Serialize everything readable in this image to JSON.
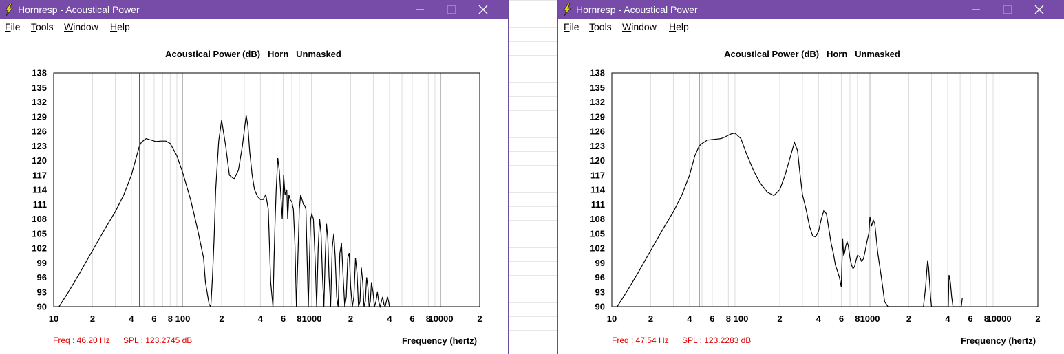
{
  "windows": [
    {
      "title": "Hornresp - Acoustical Power",
      "menu": [
        {
          "key": "F",
          "rest": "ile"
        },
        {
          "key": "T",
          "rest": "ools"
        },
        {
          "key": "W",
          "rest": "indow"
        },
        {
          "key": "H",
          "rest": "elp"
        }
      ],
      "chart_data": {
        "type": "line",
        "title": "Acoustical Power (dB)   Horn   Unmasked",
        "xlabel": "Frequency (hertz)",
        "ylabel": "",
        "x_scale": "log",
        "xlim": [
          10,
          20000
        ],
        "ylim": [
          90,
          138
        ],
        "y_ticks": [
          138,
          135,
          132,
          129,
          126,
          123,
          120,
          117,
          114,
          111,
          108,
          105,
          102,
          99,
          96,
          93,
          90
        ],
        "x_tick_labels": [
          "10",
          "2",
          "4",
          "6",
          "8",
          "100",
          "2",
          "4",
          "6",
          "8",
          "1000",
          "2",
          "4",
          "6",
          "8",
          "10000",
          "2"
        ],
        "x_tick_values": [
          10,
          20,
          40,
          60,
          80,
          100,
          200,
          400,
          600,
          800,
          1000,
          2000,
          4000,
          6000,
          8000,
          10000,
          20000
        ],
        "grid": true,
        "cursor_freq": 46.2,
        "line_color": "#000000",
        "cursor_color": "#e00000",
        "series": [
          {
            "x": [
              11,
              13,
              16,
              20,
              25,
              30,
              35,
              40,
              44,
              46.2,
              48,
              52,
              57,
              62,
              68,
              74,
              80,
              90,
              100,
              115,
              130,
              145,
              150,
              160,
              165,
              170,
              175,
              180,
              190,
              200,
              215,
              230,
              250,
              270,
              290,
              310,
              320,
              330,
              345,
              360,
              380,
              400,
              420,
              440,
              460,
              480,
              500,
              510,
              520,
              530,
              545,
              560,
              575,
              590,
              605,
              620,
              640,
              650,
              665,
              680,
              700,
              720,
              740,
              760,
              780,
              800,
              820,
              840,
              860,
              880,
              900,
              920,
              940,
              960,
              980,
              1000,
              1030,
              1060,
              1090,
              1120,
              1150,
              1180,
              1210,
              1240,
              1270,
              1300,
              1330,
              1360,
              1400,
              1440,
              1480,
              1520,
              1560,
              1600,
              1650,
              1700,
              1750,
              1800,
              1850,
              1900,
              1950,
              2000,
              2060,
              2120,
              2180,
              2240,
              2300,
              2360,
              2420,
              2480,
              2540,
              2600,
              2660,
              2720,
              2780,
              2840,
              2900,
              2980,
              3060,
              3140,
              3220,
              3300,
              3380,
              3460,
              3540,
              3620,
              3700,
              3780,
              3860,
              3940,
              4000,
              4040,
              4080
            ],
            "y": [
              90,
              93,
              97,
              101.5,
              106,
              109.5,
              113,
              117,
              121,
              123,
              123.8,
              124.5,
              124.2,
              123.9,
              124,
              124,
              123.5,
              121,
              117.5,
              112,
              106,
              100,
              95,
              90.5,
              90,
              96,
              104,
              114,
              124,
              128.3,
              123,
              117,
              116.2,
              118,
              123,
              129.3,
              127,
              122,
              117,
              114,
              112.6,
              112,
              112,
              113,
              110,
              95,
              90,
              100,
              108,
              114,
              120.5,
              118,
              113,
              108,
              117,
              113,
              114,
              108,
              113,
              112,
              111.5,
              110,
              103,
              90,
              100,
              110,
              113,
              112,
              111,
              110.8,
              110,
              100,
              90,
              100,
              108,
              109,
              108,
              100,
              90,
              102,
              108,
              105,
              96,
              90,
              100,
              107,
              104,
              96,
              90,
              102,
              105,
              100,
              92,
              90,
              101,
              103,
              96,
              90,
              92,
              100,
              101,
              94,
              90,
              92,
              100,
              97,
              90,
              91,
              98,
              95,
              90,
              91,
              96,
              94,
              90,
              91,
              95,
              93,
              90,
              91,
              93,
              91,
              90,
              91,
              92,
              90.5,
              90,
              91,
              92,
              91,
              90
            ]
          }
        ]
      },
      "status": {
        "freq": "Freq : 46.20 Hz",
        "spl": "SPL : 123.2745 dB"
      }
    },
    {
      "title": "Hornresp - Acoustical Power",
      "menu": [
        {
          "key": "F",
          "rest": "ile"
        },
        {
          "key": "T",
          "rest": "ools"
        },
        {
          "key": "W",
          "rest": "indow"
        },
        {
          "key": "H",
          "rest": "elp"
        }
      ],
      "chart_data": {
        "type": "line",
        "title": "Acoustical Power (dB)   Horn   Unmasked",
        "xlabel": "Frequency (hertz)",
        "ylabel": "",
        "x_scale": "log",
        "xlim": [
          10,
          20000
        ],
        "ylim": [
          90,
          138
        ],
        "y_ticks": [
          138,
          135,
          132,
          129,
          126,
          123,
          120,
          117,
          114,
          111,
          108,
          105,
          102,
          99,
          96,
          93,
          90
        ],
        "x_tick_labels": [
          "10",
          "2",
          "4",
          "6",
          "8",
          "100",
          "2",
          "4",
          "6",
          "8",
          "1000",
          "2",
          "4",
          "6",
          "8",
          "10000",
          "2"
        ],
        "x_tick_values": [
          10,
          20,
          40,
          60,
          80,
          100,
          200,
          400,
          600,
          800,
          1000,
          2000,
          4000,
          6000,
          8000,
          10000,
          20000
        ],
        "grid": true,
        "cursor_freq": 47.54,
        "line_color": "#000000",
        "cursor_color": "#e00000",
        "series": [
          {
            "x": [
              11,
              13,
              16,
              20,
              25,
              30,
              35,
              40,
              44,
              47.54,
              50,
              55,
              60,
              65,
              70,
              75,
              80,
              85,
              90,
              100,
              110,
              125,
              140,
              160,
              180,
              200,
              220,
              240,
              260,
              275,
              285,
              300,
              320,
              340,
              360,
              380,
              400,
              420,
              440,
              460,
              480,
              500,
              520,
              540,
              560,
              580,
              600,
              615,
              625,
              635,
              650,
              665,
              680,
              700,
              720,
              740,
              760,
              780,
              800,
              830,
              860,
              890,
              920,
              950,
              980,
              1000,
              1030,
              1060,
              1090,
              1120,
              1150,
              1180,
              1210,
              1240,
              1270,
              1300,
              1340,
              1380,
              1420,
              1460,
              1500,
              1550,
              1600,
              1650,
              1700,
              1750,
              1800,
              1850,
              1900,
              1950,
              2000,
              2050,
              2100,
              2150,
              2200,
              2300,
              2400,
              2500,
              2600,
              2700,
              2750,
              2800,
              2850,
              2900,
              2950,
              3000,
              3100,
              3200,
              3300,
              3400,
              3500,
              3600,
              3700,
              3800,
              3850,
              3900,
              3950,
              4000,
              4050,
              4100,
              4200,
              4300,
              4400,
              4500,
              4600,
              4700,
              4800,
              4900,
              5000,
              5100,
              5200
            ],
            "y": [
              90,
              93,
              97,
              101.5,
              106,
              109.5,
              113,
              117,
              121,
              123,
              123.5,
              124.2,
              124.3,
              124.4,
              124.5,
              124.8,
              125.2,
              125.5,
              125.6,
              124.5,
              121.5,
              118,
              115.5,
              113.5,
              112.8,
              114,
              117,
              120.5,
              123.7,
              122,
              118,
              113,
              110,
              106.5,
              104.5,
              104.3,
              105.5,
              108,
              109.8,
              109,
              106,
              103,
              101,
              98.5,
              97.3,
              96,
              94,
              104,
              100.5,
              101,
              102.5,
              103.3,
              102.5,
              100,
              98.5,
              97.8,
              98.2,
              99.5,
              100.5,
              100.3,
              99.3,
              99.8,
              101.5,
              103.5,
              105,
              108.5,
              106.5,
              107.8,
              107,
              104,
              101,
              99,
              97,
              95,
              93,
              91,
              90.5,
              90,
              90,
              90,
              90,
              90,
              90,
              90,
              90,
              90,
              90,
              90,
              90,
              90,
              90,
              90,
              90,
              90,
              90,
              90,
              90,
              90,
              90,
              94,
              97,
              99.5,
              98,
              95,
              92,
              90,
              90,
              90,
              90,
              90,
              90,
              90,
              90,
              90,
              90,
              90,
              90,
              90,
              90,
              96.5,
              95,
              92,
              90,
              90,
              90,
              90,
              90,
              90,
              90,
              90,
              91.8,
              90,
              90
            ]
          }
        ]
      },
      "status": {
        "freq": "Freq : 47.54 Hz",
        "spl": "SPL : 123.2283 dB"
      }
    }
  ]
}
